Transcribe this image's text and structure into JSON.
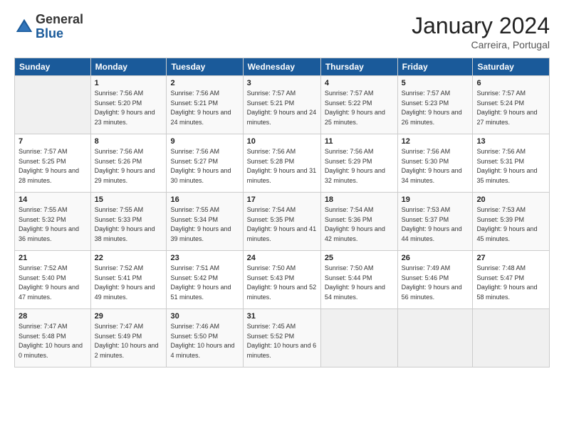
{
  "header": {
    "logo_general": "General",
    "logo_blue": "Blue",
    "month_title": "January 2024",
    "location": "Carreira, Portugal"
  },
  "days_of_week": [
    "Sunday",
    "Monday",
    "Tuesday",
    "Wednesday",
    "Thursday",
    "Friday",
    "Saturday"
  ],
  "weeks": [
    [
      {
        "day": "",
        "sunrise": "",
        "sunset": "",
        "daylight": ""
      },
      {
        "day": "1",
        "sunrise": "7:56 AM",
        "sunset": "5:20 PM",
        "daylight": "9 hours and 23 minutes."
      },
      {
        "day": "2",
        "sunrise": "7:56 AM",
        "sunset": "5:21 PM",
        "daylight": "9 hours and 24 minutes."
      },
      {
        "day": "3",
        "sunrise": "7:57 AM",
        "sunset": "5:21 PM",
        "daylight": "9 hours and 24 minutes."
      },
      {
        "day": "4",
        "sunrise": "7:57 AM",
        "sunset": "5:22 PM",
        "daylight": "9 hours and 25 minutes."
      },
      {
        "day": "5",
        "sunrise": "7:57 AM",
        "sunset": "5:23 PM",
        "daylight": "9 hours and 26 minutes."
      },
      {
        "day": "6",
        "sunrise": "7:57 AM",
        "sunset": "5:24 PM",
        "daylight": "9 hours and 27 minutes."
      }
    ],
    [
      {
        "day": "7",
        "sunrise": "7:57 AM",
        "sunset": "5:25 PM",
        "daylight": "9 hours and 28 minutes."
      },
      {
        "day": "8",
        "sunrise": "7:56 AM",
        "sunset": "5:26 PM",
        "daylight": "9 hours and 29 minutes."
      },
      {
        "day": "9",
        "sunrise": "7:56 AM",
        "sunset": "5:27 PM",
        "daylight": "9 hours and 30 minutes."
      },
      {
        "day": "10",
        "sunrise": "7:56 AM",
        "sunset": "5:28 PM",
        "daylight": "9 hours and 31 minutes."
      },
      {
        "day": "11",
        "sunrise": "7:56 AM",
        "sunset": "5:29 PM",
        "daylight": "9 hours and 32 minutes."
      },
      {
        "day": "12",
        "sunrise": "7:56 AM",
        "sunset": "5:30 PM",
        "daylight": "9 hours and 34 minutes."
      },
      {
        "day": "13",
        "sunrise": "7:56 AM",
        "sunset": "5:31 PM",
        "daylight": "9 hours and 35 minutes."
      }
    ],
    [
      {
        "day": "14",
        "sunrise": "7:55 AM",
        "sunset": "5:32 PM",
        "daylight": "9 hours and 36 minutes."
      },
      {
        "day": "15",
        "sunrise": "7:55 AM",
        "sunset": "5:33 PM",
        "daylight": "9 hours and 38 minutes."
      },
      {
        "day": "16",
        "sunrise": "7:55 AM",
        "sunset": "5:34 PM",
        "daylight": "9 hours and 39 minutes."
      },
      {
        "day": "17",
        "sunrise": "7:54 AM",
        "sunset": "5:35 PM",
        "daylight": "9 hours and 41 minutes."
      },
      {
        "day": "18",
        "sunrise": "7:54 AM",
        "sunset": "5:36 PM",
        "daylight": "9 hours and 42 minutes."
      },
      {
        "day": "19",
        "sunrise": "7:53 AM",
        "sunset": "5:37 PM",
        "daylight": "9 hours and 44 minutes."
      },
      {
        "day": "20",
        "sunrise": "7:53 AM",
        "sunset": "5:39 PM",
        "daylight": "9 hours and 45 minutes."
      }
    ],
    [
      {
        "day": "21",
        "sunrise": "7:52 AM",
        "sunset": "5:40 PM",
        "daylight": "9 hours and 47 minutes."
      },
      {
        "day": "22",
        "sunrise": "7:52 AM",
        "sunset": "5:41 PM",
        "daylight": "9 hours and 49 minutes."
      },
      {
        "day": "23",
        "sunrise": "7:51 AM",
        "sunset": "5:42 PM",
        "daylight": "9 hours and 51 minutes."
      },
      {
        "day": "24",
        "sunrise": "7:50 AM",
        "sunset": "5:43 PM",
        "daylight": "9 hours and 52 minutes."
      },
      {
        "day": "25",
        "sunrise": "7:50 AM",
        "sunset": "5:44 PM",
        "daylight": "9 hours and 54 minutes."
      },
      {
        "day": "26",
        "sunrise": "7:49 AM",
        "sunset": "5:46 PM",
        "daylight": "9 hours and 56 minutes."
      },
      {
        "day": "27",
        "sunrise": "7:48 AM",
        "sunset": "5:47 PM",
        "daylight": "9 hours and 58 minutes."
      }
    ],
    [
      {
        "day": "28",
        "sunrise": "7:47 AM",
        "sunset": "5:48 PM",
        "daylight": "10 hours and 0 minutes."
      },
      {
        "day": "29",
        "sunrise": "7:47 AM",
        "sunset": "5:49 PM",
        "daylight": "10 hours and 2 minutes."
      },
      {
        "day": "30",
        "sunrise": "7:46 AM",
        "sunset": "5:50 PM",
        "daylight": "10 hours and 4 minutes."
      },
      {
        "day": "31",
        "sunrise": "7:45 AM",
        "sunset": "5:52 PM",
        "daylight": "10 hours and 6 minutes."
      },
      {
        "day": "",
        "sunrise": "",
        "sunset": "",
        "daylight": ""
      },
      {
        "day": "",
        "sunrise": "",
        "sunset": "",
        "daylight": ""
      },
      {
        "day": "",
        "sunrise": "",
        "sunset": "",
        "daylight": ""
      }
    ]
  ]
}
